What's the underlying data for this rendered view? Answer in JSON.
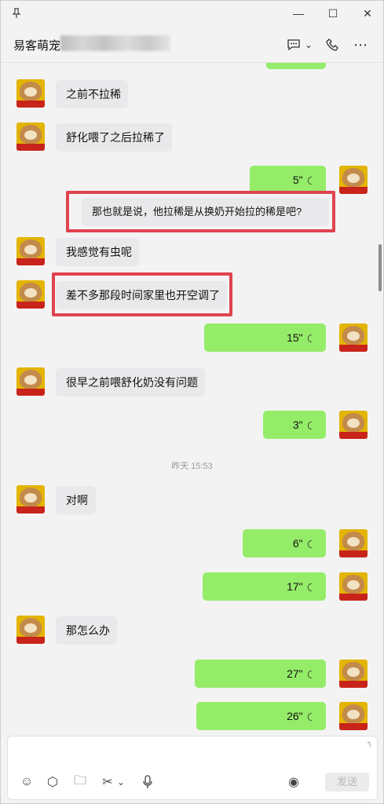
{
  "window": {
    "pin_icon": "pin-icon",
    "minimize_glyph": "—",
    "maximize_glyph": "☐",
    "close_glyph": "✕"
  },
  "header": {
    "contact_name": "易客萌宠",
    "chat_icon_glyph": "💬",
    "chevron_glyph": "⌄",
    "call_icon_glyph": "☏",
    "more_glyph": "⋯"
  },
  "messages": [
    {
      "side": "in",
      "type": "text",
      "text": "之前不拉稀"
    },
    {
      "side": "in",
      "type": "text",
      "text": "舒化喂了之后拉稀了"
    },
    {
      "side": "out",
      "type": "voice",
      "duration": "5\""
    },
    {
      "side": "in",
      "type": "quote",
      "text": "那也就是说，他拉稀是从换奶开始拉的稀是吧?"
    },
    {
      "side": "in",
      "type": "text",
      "text": "我感觉有虫呢"
    },
    {
      "side": "in",
      "type": "text",
      "text": "差不多那段时间家里也开空调了"
    },
    {
      "side": "out",
      "type": "voice",
      "duration": "15\""
    },
    {
      "side": "in",
      "type": "text",
      "text": "很早之前喂舒化奶没有问题"
    },
    {
      "side": "out",
      "type": "voice",
      "duration": "3\""
    },
    {
      "side": "system",
      "type": "time",
      "text": "昨天 15:53"
    },
    {
      "side": "in",
      "type": "text",
      "text": "对啊"
    },
    {
      "side": "out",
      "type": "voice",
      "duration": "6\""
    },
    {
      "side": "out",
      "type": "voice",
      "duration": "17\""
    },
    {
      "side": "in",
      "type": "text",
      "text": "那怎么办"
    },
    {
      "side": "out",
      "type": "voice",
      "duration": "27\""
    },
    {
      "side": "out",
      "type": "voice",
      "duration": "26\""
    }
  ],
  "toolbar": {
    "emoji_glyph": "☺",
    "favorites_glyph": "⬡",
    "folder_glyph": "🗀",
    "scissors_glyph": "✂",
    "chevron_glyph": "⌄",
    "mic_glyph": "🎙",
    "voice_call_glyph": "◉",
    "send_label": "发送"
  },
  "colors": {
    "outgoing_bubble": "#95ec69",
    "incoming_bubble": "#e9e9eb",
    "highlight_border": "#e0434f"
  }
}
